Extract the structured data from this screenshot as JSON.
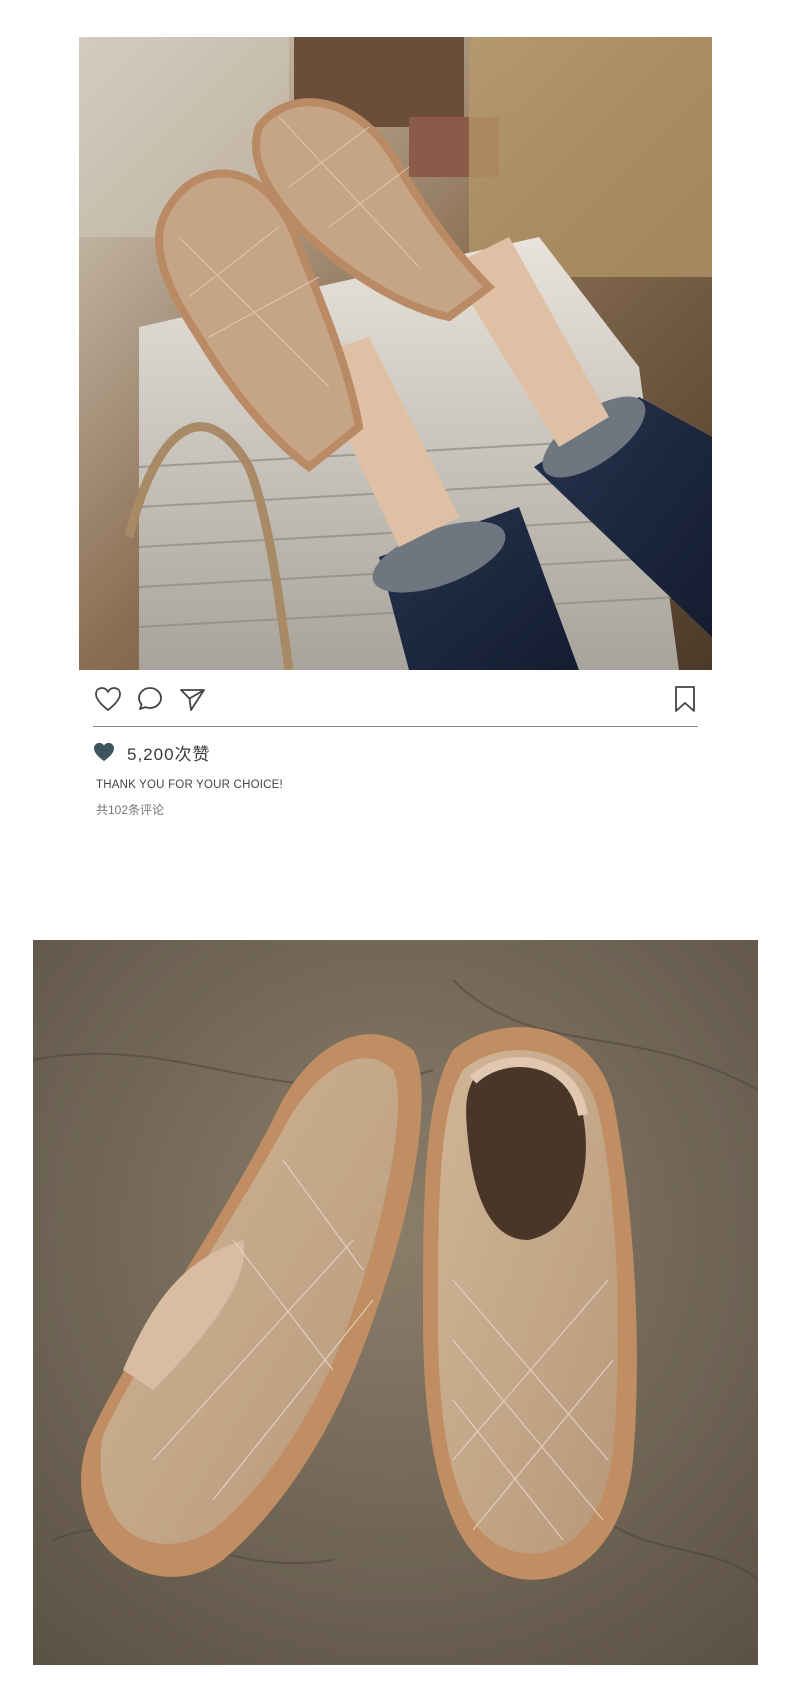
{
  "post": {
    "photo_alt": "",
    "likes_text": "5,200次赞",
    "caption": "THANK YOU FOR YOUR CHOICE!",
    "comments_text": "共102条评论"
  },
  "actions": {
    "like_icon": "heart-outline-icon",
    "comment_icon": "speech-bubble-icon",
    "share_icon": "paper-plane-icon",
    "bookmark_icon": "bookmark-icon",
    "liked_icon": "heart-filled-icon"
  },
  "colors": {
    "icon": "#444444",
    "liked_heart": "#3e5560",
    "divider": "#8a8a8a",
    "shoe": "#c6a486",
    "sole": "#b98a64"
  }
}
